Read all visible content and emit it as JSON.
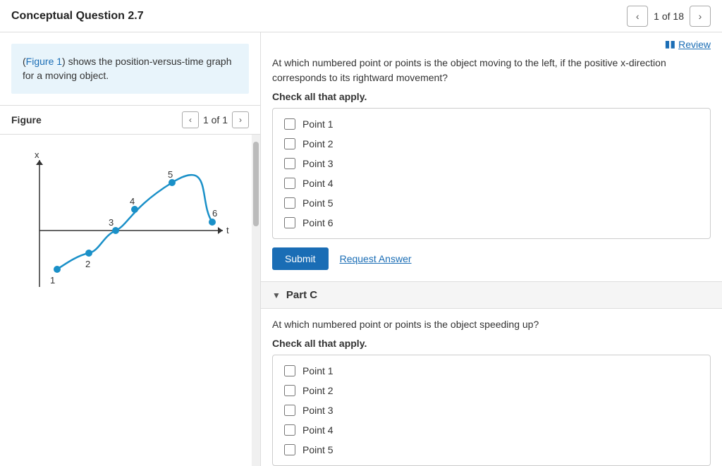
{
  "header": {
    "title": "Conceptual Question 2.7",
    "nav_prev": "‹",
    "nav_next": "›",
    "page_label": "1 of 18"
  },
  "figure": {
    "title": "Figure",
    "page_label": "1 of 1",
    "description_link": "Figure 1",
    "description_text": " shows the position-versus-time graph for a moving object."
  },
  "review": {
    "icon": "▮▮",
    "label": "Review"
  },
  "part_b": {
    "question": "At which numbered point or points is the object moving to the left, if the positive x-direction corresponds to its rightward movement?",
    "check_label": "Check all that apply.",
    "options": [
      "Point 1",
      "Point 2",
      "Point 3",
      "Point 4",
      "Point 5",
      "Point 6"
    ],
    "submit_label": "Submit",
    "request_label": "Request Answer"
  },
  "part_c": {
    "section_label": "Part C",
    "question": "At which numbered point or points is the object speeding up?",
    "check_label": "Check all that apply.",
    "options": [
      "Point 1",
      "Point 2",
      "Point 3",
      "Point 4",
      "Point 5"
    ]
  }
}
